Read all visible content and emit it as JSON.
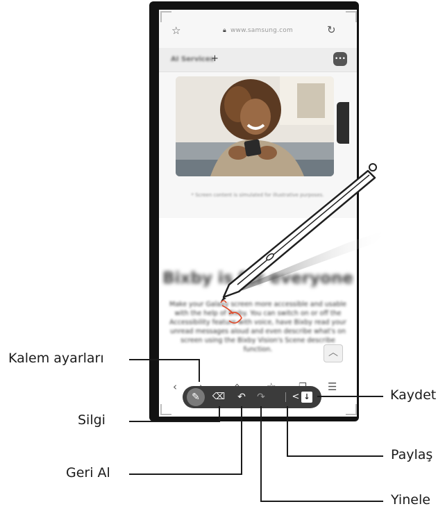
{
  "browser": {
    "url": "www.samsung.com",
    "tab_title": "AI Services",
    "tab_add": "+",
    "side_handle_label": "Sidebar"
  },
  "article": {
    "caption": "* Screen content is simulated for illustrative purposes.",
    "headline": "Bixby is for everyone",
    "paragraph": "Make your Galaxy screen more accessible and usable with the help of Bixby. You can switch on or off the Accessibility feature with voice, have Bixby read your unread messages aloud and even describe what's on screen using the Bixby Vision's Scene describe function."
  },
  "nav": {
    "icons": [
      "back-icon",
      "forward-icon",
      "home-icon",
      "bookmark-add-icon",
      "tabs-icon",
      "menu-icon"
    ]
  },
  "toolbar": {
    "icons": [
      "pen-icon",
      "eraser-icon",
      "undo-icon",
      "redo-icon",
      "share-icon",
      "save-icon"
    ]
  },
  "callouts": {
    "pen_settings": "Kalem ayarları",
    "eraser": "Silgi",
    "undo": "Geri Al",
    "redo": "Yinele",
    "share": "Paylaş",
    "save": "Kaydet"
  },
  "colors": {
    "toolbar_bg": "#3b3b3b",
    "phone_frame": "#121212",
    "ink_red": "#e04a2a"
  }
}
